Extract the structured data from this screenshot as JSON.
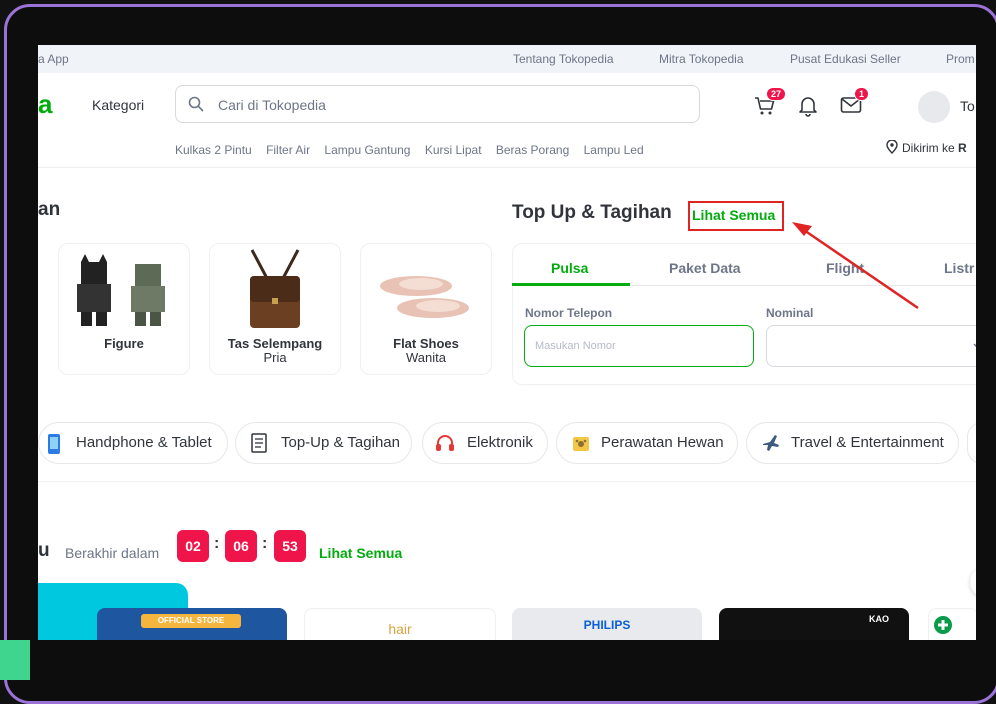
{
  "topbar": {
    "app_label": "a App",
    "links": [
      "Tentang Tokopedia",
      "Mitra Tokopedia",
      "Pusat Edukasi Seller",
      "Prom"
    ]
  },
  "header": {
    "logo_text": "a",
    "kategori_label": "Kategori",
    "search_placeholder": "Cari di Tokopedia",
    "cart_badge": "27",
    "message_badge": "1",
    "username": "To"
  },
  "suggestions": [
    "Kulkas 2 Pintu",
    "Filter Air",
    "Lampu Gantung",
    "Kursi Lipat",
    "Beras Porang",
    "Lampu Led"
  ],
  "delivery": {
    "prefix": "Dikirim ke",
    "location": "R"
  },
  "category_section": {
    "title": "an",
    "cards": [
      {
        "title": "Figure",
        "subtitle": ""
      },
      {
        "title": "Tas Selempang",
        "subtitle": "Pria"
      },
      {
        "title": "Flat Shoes",
        "subtitle": "Wanita"
      }
    ]
  },
  "topup": {
    "title": "Top Up & Tagihan",
    "see_all": "Lihat Semua",
    "tabs": [
      "Pulsa",
      "Paket Data",
      "Flight",
      "Listr"
    ],
    "phone_label": "Nomor Telepon",
    "phone_placeholder": "Masukan Nomor",
    "nominal_label": "Nominal"
  },
  "category_pills": [
    "Handphone & Tablet",
    "Top-Up & Tagihan",
    "Elektronik",
    "Perawatan Hewan",
    "Travel & Entertainment"
  ],
  "flash_sale": {
    "title_fragment": "u",
    "ends_label": "Berakhir dalam",
    "hours": "02",
    "minutes": "06",
    "seconds": "53",
    "see_all": "Lihat Semua"
  },
  "products": [
    {
      "brand": "OFFICIAL STORE"
    },
    {
      "brand": "hair"
    },
    {
      "brand": "PHILIPS"
    },
    {
      "brand": "KAO"
    }
  ],
  "colors": {
    "accent_green": "#03ac0e",
    "badge_red": "#ef144a",
    "annotation_red": "#e02424",
    "bezel_purple": "#9b72d8"
  }
}
